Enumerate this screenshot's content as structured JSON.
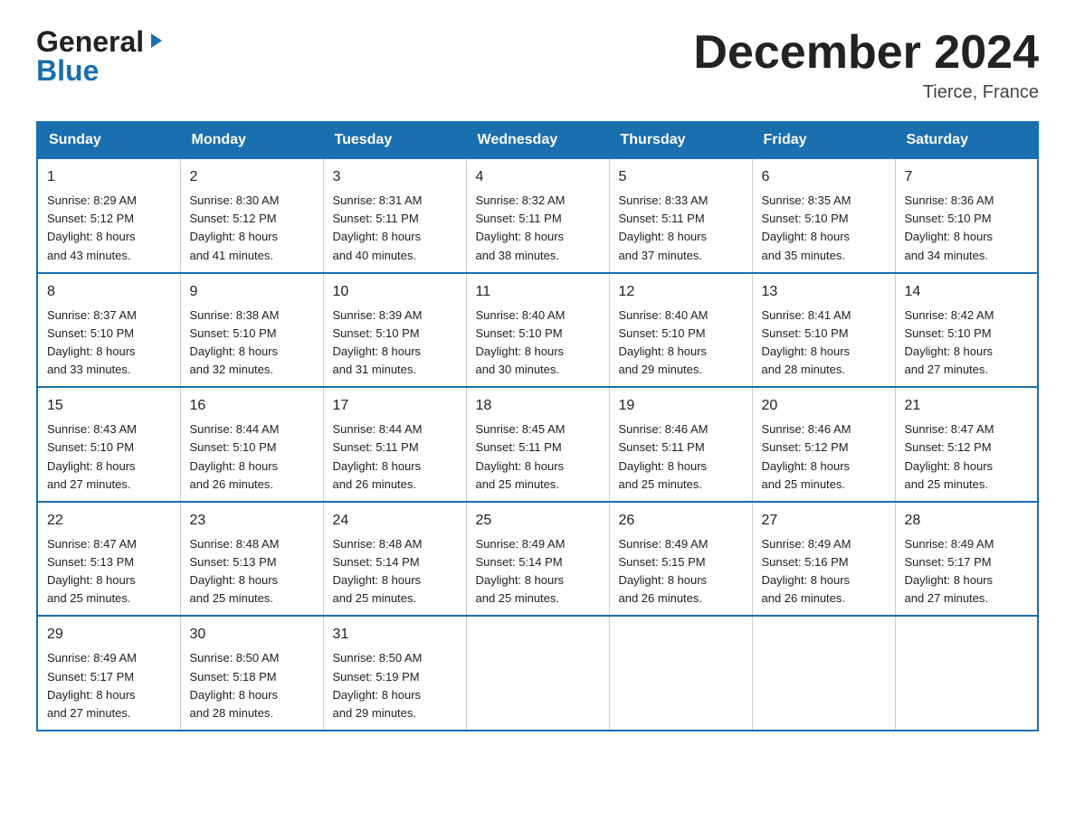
{
  "header": {
    "logo_general": "General",
    "logo_blue": "Blue",
    "month_title": "December 2024",
    "location": "Tierce, France"
  },
  "calendar": {
    "days_of_week": [
      "Sunday",
      "Monday",
      "Tuesday",
      "Wednesday",
      "Thursday",
      "Friday",
      "Saturday"
    ],
    "weeks": [
      [
        {
          "day": "1",
          "sunrise": "8:29 AM",
          "sunset": "5:12 PM",
          "daylight": "8 hours and 43 minutes."
        },
        {
          "day": "2",
          "sunrise": "8:30 AM",
          "sunset": "5:12 PM",
          "daylight": "8 hours and 41 minutes."
        },
        {
          "day": "3",
          "sunrise": "8:31 AM",
          "sunset": "5:11 PM",
          "daylight": "8 hours and 40 minutes."
        },
        {
          "day": "4",
          "sunrise": "8:32 AM",
          "sunset": "5:11 PM",
          "daylight": "8 hours and 38 minutes."
        },
        {
          "day": "5",
          "sunrise": "8:33 AM",
          "sunset": "5:11 PM",
          "daylight": "8 hours and 37 minutes."
        },
        {
          "day": "6",
          "sunrise": "8:35 AM",
          "sunset": "5:10 PM",
          "daylight": "8 hours and 35 minutes."
        },
        {
          "day": "7",
          "sunrise": "8:36 AM",
          "sunset": "5:10 PM",
          "daylight": "8 hours and 34 minutes."
        }
      ],
      [
        {
          "day": "8",
          "sunrise": "8:37 AM",
          "sunset": "5:10 PM",
          "daylight": "8 hours and 33 minutes."
        },
        {
          "day": "9",
          "sunrise": "8:38 AM",
          "sunset": "5:10 PM",
          "daylight": "8 hours and 32 minutes."
        },
        {
          "day": "10",
          "sunrise": "8:39 AM",
          "sunset": "5:10 PM",
          "daylight": "8 hours and 31 minutes."
        },
        {
          "day": "11",
          "sunrise": "8:40 AM",
          "sunset": "5:10 PM",
          "daylight": "8 hours and 30 minutes."
        },
        {
          "day": "12",
          "sunrise": "8:40 AM",
          "sunset": "5:10 PM",
          "daylight": "8 hours and 29 minutes."
        },
        {
          "day": "13",
          "sunrise": "8:41 AM",
          "sunset": "5:10 PM",
          "daylight": "8 hours and 28 minutes."
        },
        {
          "day": "14",
          "sunrise": "8:42 AM",
          "sunset": "5:10 PM",
          "daylight": "8 hours and 27 minutes."
        }
      ],
      [
        {
          "day": "15",
          "sunrise": "8:43 AM",
          "sunset": "5:10 PM",
          "daylight": "8 hours and 27 minutes."
        },
        {
          "day": "16",
          "sunrise": "8:44 AM",
          "sunset": "5:10 PM",
          "daylight": "8 hours and 26 minutes."
        },
        {
          "day": "17",
          "sunrise": "8:44 AM",
          "sunset": "5:11 PM",
          "daylight": "8 hours and 26 minutes."
        },
        {
          "day": "18",
          "sunrise": "8:45 AM",
          "sunset": "5:11 PM",
          "daylight": "8 hours and 25 minutes."
        },
        {
          "day": "19",
          "sunrise": "8:46 AM",
          "sunset": "5:11 PM",
          "daylight": "8 hours and 25 minutes."
        },
        {
          "day": "20",
          "sunrise": "8:46 AM",
          "sunset": "5:12 PM",
          "daylight": "8 hours and 25 minutes."
        },
        {
          "day": "21",
          "sunrise": "8:47 AM",
          "sunset": "5:12 PM",
          "daylight": "8 hours and 25 minutes."
        }
      ],
      [
        {
          "day": "22",
          "sunrise": "8:47 AM",
          "sunset": "5:13 PM",
          "daylight": "8 hours and 25 minutes."
        },
        {
          "day": "23",
          "sunrise": "8:48 AM",
          "sunset": "5:13 PM",
          "daylight": "8 hours and 25 minutes."
        },
        {
          "day": "24",
          "sunrise": "8:48 AM",
          "sunset": "5:14 PM",
          "daylight": "8 hours and 25 minutes."
        },
        {
          "day": "25",
          "sunrise": "8:49 AM",
          "sunset": "5:14 PM",
          "daylight": "8 hours and 25 minutes."
        },
        {
          "day": "26",
          "sunrise": "8:49 AM",
          "sunset": "5:15 PM",
          "daylight": "8 hours and 26 minutes."
        },
        {
          "day": "27",
          "sunrise": "8:49 AM",
          "sunset": "5:16 PM",
          "daylight": "8 hours and 26 minutes."
        },
        {
          "day": "28",
          "sunrise": "8:49 AM",
          "sunset": "5:17 PM",
          "daylight": "8 hours and 27 minutes."
        }
      ],
      [
        {
          "day": "29",
          "sunrise": "8:49 AM",
          "sunset": "5:17 PM",
          "daylight": "8 hours and 27 minutes."
        },
        {
          "day": "30",
          "sunrise": "8:50 AM",
          "sunset": "5:18 PM",
          "daylight": "8 hours and 28 minutes."
        },
        {
          "day": "31",
          "sunrise": "8:50 AM",
          "sunset": "5:19 PM",
          "daylight": "8 hours and 29 minutes."
        },
        null,
        null,
        null,
        null
      ]
    ],
    "labels": {
      "sunrise": "Sunrise:",
      "sunset": "Sunset:",
      "daylight": "Daylight:"
    }
  }
}
